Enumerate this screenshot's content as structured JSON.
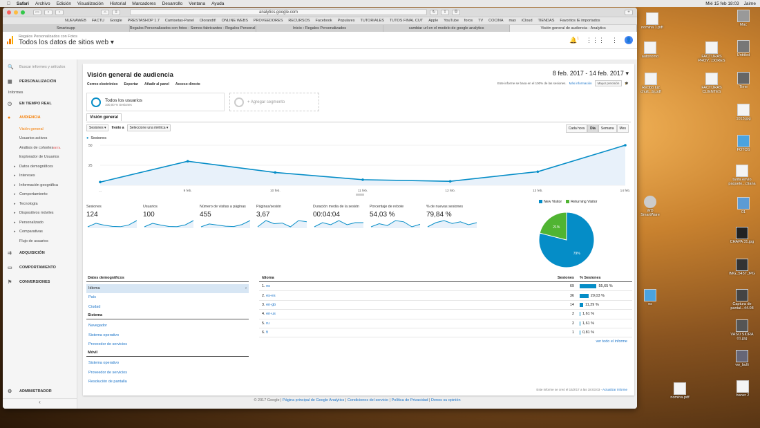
{
  "menubar": {
    "app": "Safari",
    "items": [
      "Archivo",
      "Edición",
      "Visualización",
      "Historial",
      "Marcadores",
      "Desarrollo",
      "Ventana",
      "Ayuda"
    ],
    "clock": "Mié 15 feb 18:03",
    "user": "Jaime"
  },
  "browser": {
    "url": "analytics.google.com",
    "bookmarks": [
      "NUEVAWEB",
      "FACTU",
      "Google",
      "PRESTASHOP 1.7",
      "Camisetas-Panel",
      "Olorandit!",
      "ONLINE WEBS",
      "PROVEEDORES",
      "RECURSOS",
      "Facebook",
      "Populares",
      "TUTORIALES",
      "TUTOS FINAL CUT",
      "Apple",
      "YouTube",
      "foros",
      "TV",
      "COCINA",
      "max",
      "iCloud",
      "TIENDAS",
      "Favoritos IE importados"
    ],
    "tabs": [
      "Smartsupp",
      "Regalos Personalizados con fotos - Somos fabricantes - Regalos Personal...",
      "Inicio › Regalos Personalizados",
      "cambiar url en el modelo de google analytics",
      "Visión general de audiencia - Analytics"
    ]
  },
  "ga": {
    "account": "Regalos Personalizados con Fotos",
    "property": "Todos los datos de sitios web",
    "notif": "1"
  },
  "sidebar": {
    "search_placeholder": "Buscar informes y artículos",
    "personalizacion": "PERSONALIZACIÓN",
    "informes": "Informes",
    "tiempo_real": "EN TIEMPO REAL",
    "audiencia": "AUDIENCIA",
    "aud_items": [
      "Visión general",
      "Usuarios activos",
      "Análisis de cohortes",
      "Explorador de Usuarios",
      "Datos demográficos",
      "Intereses",
      "Información geográfica",
      "Comportamiento",
      "Tecnología",
      "Dispositivos móviles",
      "Personalizado",
      "Comparativas",
      "Flujo de usuarios"
    ],
    "beta": "BETA",
    "adquisicion": "ADQUISICIÓN",
    "comportamiento": "COMPORTAMIENTO",
    "conversiones": "CONVERSIONES",
    "administrador": "ADMINISTRADOR"
  },
  "report": {
    "title": "Visión general de audiencia",
    "date_range": "8 feb. 2017 - 14 feb. 2017",
    "toolbar": [
      "Correo electrónico",
      "Exportar",
      "Añadir al panel",
      "Acceso directo"
    ],
    "sampling_text": "Este informe se basa en el 100% de las sesiones.",
    "more_info": "Más información",
    "precision": "Mayor precisión",
    "segment": "Todos los usuarios",
    "segment_sub": "100,00 % Sesiones",
    "add_segment": "+ Agregar segmento",
    "view_tab": "Visión general",
    "metric_select": "Sesiones",
    "vs_label": "frente a",
    "metric2": "Seleccione una métrica",
    "granularity": [
      "Cada hora",
      "Día",
      "Semana",
      "Mes"
    ],
    "chart_legend": "Sesiones"
  },
  "chart_data": [
    {
      "type": "line",
      "title": "",
      "series": [
        {
          "name": "Sesiones",
          "values": [
            4,
            30,
            16,
            7,
            5,
            17,
            50
          ]
        }
      ],
      "x": [
        "8 feb.",
        "9 feb.",
        "10 feb.",
        "11 feb.",
        "12 feb.",
        "13 feb.",
        "14 feb."
      ],
      "x_labels_shown": [
        "...",
        "9 feb.",
        "10 feb.",
        "11 feb.",
        "12 feb.",
        "13 feb.",
        "14 feb."
      ],
      "yticks": [
        "50",
        "25"
      ],
      "ylim": [
        0,
        50
      ],
      "grid": true,
      "color": "#058dc7"
    },
    {
      "type": "pie",
      "series": [
        {
          "name": "New Visitor",
          "value": 79,
          "label": "79%",
          "color": "#058dc7"
        },
        {
          "name": "Returning Visitor",
          "value": 21,
          "label": "21%",
          "color": "#50b432"
        }
      ],
      "legend": "top"
    }
  ],
  "stats": [
    {
      "label": "Sesiones",
      "value": "124"
    },
    {
      "label": "Usuarios",
      "value": "100"
    },
    {
      "label": "Número de visitas a páginas",
      "value": "455"
    },
    {
      "label": "Páginas/sesión",
      "value": "3,67"
    },
    {
      "label": "Duración media de la sesión",
      "value": "00:04:04"
    },
    {
      "label": "Porcentaje de rebote",
      "value": "54,03 %"
    },
    {
      "label": "% de nuevas sesiones",
      "value": "79,84 %"
    }
  ],
  "demographics": {
    "header": "Datos demográficos",
    "items": [
      "Idioma",
      "País",
      "Ciudad"
    ],
    "system_header": "Sistema",
    "system_items": [
      "Navegador",
      "Sistema operativo",
      "Proveedor de servicios"
    ],
    "mobile_header": "Móvil",
    "mobile_items": [
      "Sistema operativo",
      "Proveedor de servicios",
      "Resolución de pantalla"
    ]
  },
  "lang_table": {
    "col1": "Idioma",
    "col2": "Sesiones",
    "col3": "% Sesiones",
    "rows": [
      {
        "n": "1.",
        "lang": "es",
        "sessions": "69",
        "pct": "55,65 %",
        "frac": 0.5565
      },
      {
        "n": "2.",
        "lang": "es-es",
        "sessions": "36",
        "pct": "29,03 %",
        "frac": 0.2903
      },
      {
        "n": "3.",
        "lang": "en-gb",
        "sessions": "14",
        "pct": "11,29 %",
        "frac": 0.1129
      },
      {
        "n": "4.",
        "lang": "en-us",
        "sessions": "2",
        "pct": "1,61 %",
        "frac": 0.0161
      },
      {
        "n": "5.",
        "lang": "ru",
        "sessions": "2",
        "pct": "1,61 %",
        "frac": 0.0161
      },
      {
        "n": "6.",
        "lang": "fi",
        "sessions": "1",
        "pct": "0,81 %",
        "frac": 0.0081
      }
    ],
    "more": "ver todo el informe"
  },
  "footer": {
    "created": "Este informe se creó el 15/2/17 a las 18:03:03 -",
    "update": "Actualizar informe",
    "copyright": "© 2017 Google |",
    "links": [
      "Página principal de Google Analytics",
      "Condiciones del servicio",
      "Política de Privacidad",
      "Denos su opinión"
    ]
  },
  "desktop": [
    "nomina 1.pdf",
    "autonomo",
    "Recibo luz chult...bj.pdf",
    "FACTURAS PROV...DORES",
    "FACTURAS CLIENTES",
    "Mac",
    "Untitled",
    "Time",
    "1015.jpg",
    "FOTOS",
    "tarifa envío paquete...ctiana",
    "01",
    "CHAPA 31.jpg",
    "IMG_5457.JPG",
    "Captura de pantal...44.08",
    "VASO SIDRA 01.jpg",
    "vw_bulli",
    "WD SmartWare",
    "es",
    "nomina.pdf",
    "baner 2"
  ]
}
